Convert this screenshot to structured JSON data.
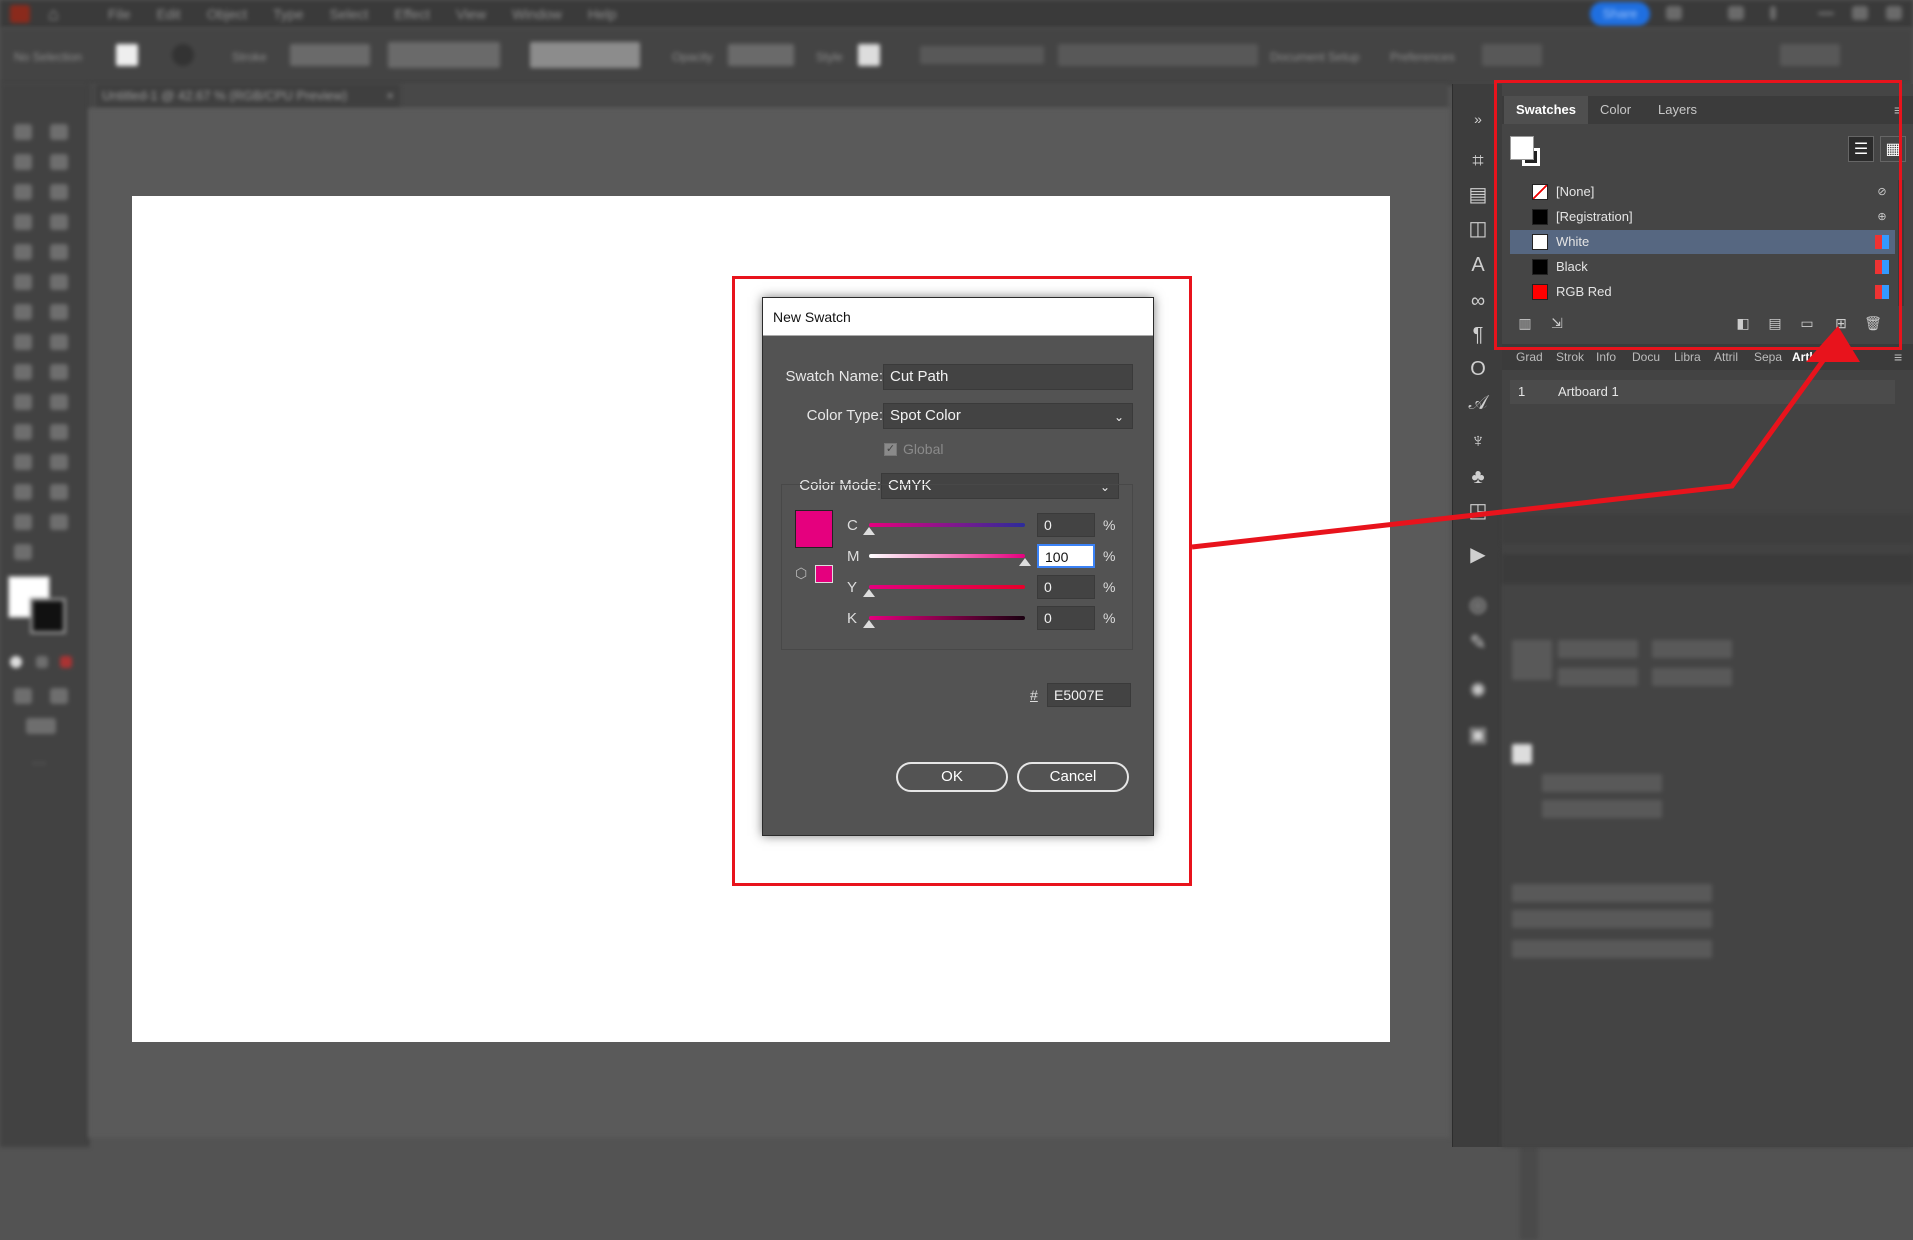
{
  "menubar": {
    "items": [
      "File",
      "Edit",
      "Object",
      "Type",
      "Select",
      "Effect",
      "View",
      "Window",
      "Help"
    ],
    "share_label": "Share"
  },
  "controlbar": {
    "no_selection": "No Selection",
    "stroke_label": "Stroke",
    "opacity_label": "Opacity",
    "style_label": "Style",
    "document_setup": "Document Setup",
    "preferences": "Preferences"
  },
  "document_tab": {
    "title": "Untitled-1 @ 42.67 % (RGB/CPU Preview)"
  },
  "swatches_panel": {
    "tabs": [
      "Swatches",
      "Color",
      "Layers"
    ],
    "active_tab": "Swatches",
    "items": [
      {
        "name": "[None]",
        "color": "none",
        "type_icon": "no-print-icon"
      },
      {
        "name": "[Registration]",
        "color": "#000000",
        "type_icon": "registration-icon"
      },
      {
        "name": "White",
        "color": "#ffffff",
        "type_icon": "process-color-icon",
        "selected": true
      },
      {
        "name": "Black",
        "color": "#000000",
        "type_icon": "process-color-icon"
      },
      {
        "name": "RGB Red",
        "color": "#ff0000",
        "type_icon": "process-color-icon"
      }
    ]
  },
  "lower_tabs": {
    "items": [
      "Grad",
      "Strok",
      "Info",
      "Docu",
      "Libra",
      "Attril",
      "Sepa",
      "Artboards"
    ],
    "active": "Artboards"
  },
  "artboards": {
    "rows": [
      {
        "index": "1",
        "name": "Artboard 1"
      }
    ]
  },
  "dialog": {
    "title": "New Swatch",
    "swatch_name_label": "Swatch Name:",
    "swatch_name_value": "Cut Path",
    "color_type_label": "Color Type:",
    "color_type_value": "Spot Color",
    "global_label": "Global",
    "color_mode_label": "Color Mode:",
    "color_mode_value": "CMYK",
    "channels": [
      {
        "label": "C",
        "value": "0",
        "fraction": 0.0
      },
      {
        "label": "M",
        "value": "100",
        "fraction": 1.0
      },
      {
        "label": "Y",
        "value": "0",
        "fraction": 0.0
      },
      {
        "label": "K",
        "value": "0",
        "fraction": 0.0
      }
    ],
    "percent_sign": "%",
    "hex_label": "#",
    "hex_value": "E5007E",
    "ok_label": "OK",
    "cancel_label": "Cancel"
  },
  "colors": {
    "swatch_color": "#e5007e",
    "annotation_red": "#e8131c",
    "selection_blue": "#566781"
  }
}
